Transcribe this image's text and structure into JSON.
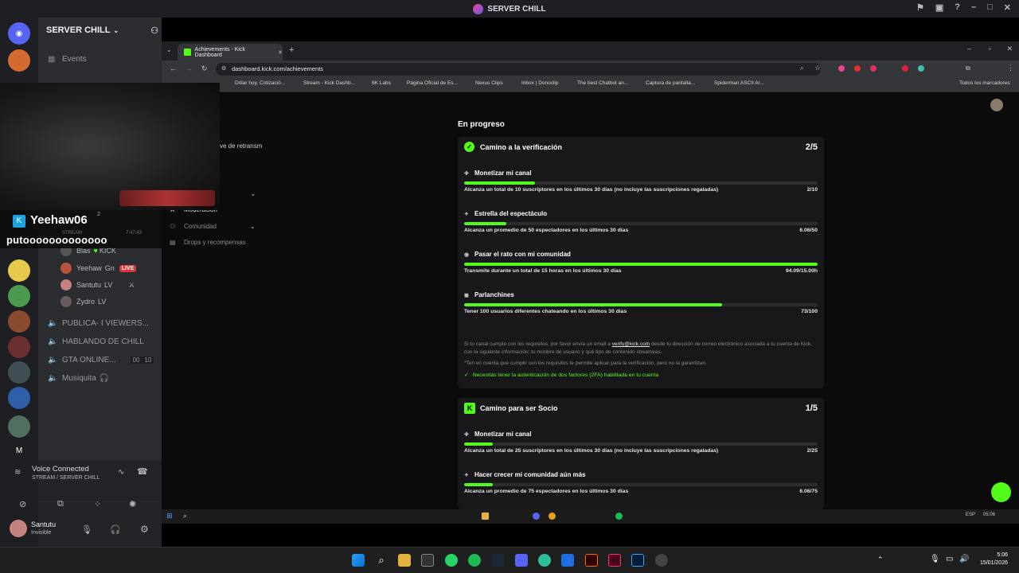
{
  "discord": {
    "title": "SERVER CHILL",
    "server_name": "SERVER CHILL",
    "events_label": "Events",
    "chat_overlay": {
      "name": "Yeehaw06",
      "message": "putooooooooooooo",
      "badge": "2",
      "time": "7:47:43",
      "stream_label": "STREAM"
    },
    "voice_users": [
      {
        "name": "Blas",
        "tag": "KICK",
        "live": false
      },
      {
        "name": "Yeehaw",
        "tag": "Gn",
        "live": true
      },
      {
        "name": "Santutu",
        "tag": "LV",
        "live": false
      },
      {
        "name": "Zydro",
        "tag": "LV",
        "live": false
      }
    ],
    "live_label": "LIVE",
    "voice_channels": [
      {
        "name": "PUBLICA- I VIEWERS..."
      },
      {
        "name": "HABLANDO DE CHILL"
      },
      {
        "name": "GTA ONLINE...",
        "count_a": "00",
        "count_b": "10"
      },
      {
        "name": "Musiquita"
      }
    ],
    "voice_status": "Voice Connected",
    "voice_channel": "STREAM / SERVER CHILL",
    "user": {
      "name": "Santutu",
      "status": "Invisible"
    }
  },
  "browser": {
    "tab_title": "Achievements - Kick Dashboard",
    "url": "dashboard.kick.com/achievements",
    "bookmarks": [
      "Dólar hoy, Cotizació...",
      "Stream - Kick Dashb...",
      "6K Labs",
      "Página Oficial de Es...",
      "Nexus Clips",
      "Inbox | Donoclip",
      "The best Chatbot an...",
      "Captura de pantalla...",
      "Spiderman ASCII Ar..."
    ],
    "all_bookmarks": "Todos los marcadores"
  },
  "dashboard": {
    "sidebar": [
      {
        "label": "ve de retransm"
      },
      {
        "label": "Moderación"
      },
      {
        "label": "Comunidad"
      },
      {
        "label": "Drops y recompensas"
      }
    ],
    "section_title": "En progreso",
    "verification": {
      "title": "Camino a la verificación",
      "score": "2/5",
      "tasks": [
        {
          "title": "Monetizar mi canal",
          "desc": "Alcanza un total de 10 suscriptores en los últimos 30 días (no incluye las suscripciones regaladas)",
          "value": "2/10",
          "progress": 0.2
        },
        {
          "title": "Estrella del espectáculo",
          "desc": "Alcanza un promedio de 50 espectadores en los últimos 30 días",
          "value": "6.06/50",
          "progress": 0.12
        },
        {
          "title": "Pasar el rato con mi comunidad",
          "desc": "Transmite durante un total de 15 horas en los últimos 30 días",
          "value": "94.09/15.00h",
          "progress": 1.0
        },
        {
          "title": "Parlanchines",
          "desc": "Tener 100 usuarios diferentes chateando en los últimos 30 días",
          "value": "73/100",
          "progress": 0.73
        }
      ],
      "note_1_pre": "Si tu canal cumple con los requisitos, por favor envía un email a",
      "note_email": "verify@kick.com",
      "note_1_post": "desde tu dirección de correo electrónico asociada a tu cuenta de Kick, con la siguiente información: tu nombre de usuario y qué tipo de contenido streameas.",
      "note_2": "*Ten en cuenta que cumplir con los requisitos te permite aplicar para la verificación, pero no la garantizan.",
      "requirement": "Necesitas tener la autenticación de dos factores (2FA) habilitada en tu cuenta"
    },
    "partner": {
      "title": "Camino para ser Socio",
      "score": "1/5",
      "tasks": [
        {
          "title": "Monetizar mi canal",
          "desc": "Alcanza un total de 25 suscriptores en los últimos 30 días (no incluye las suscripciones regaladas)",
          "value": "2/25",
          "progress": 0.08
        },
        {
          "title": "Hacer crecer mi comunidad aún más",
          "desc": "Alcanza un promedio de 75 espectadores en los últimos 30 días",
          "value": "6.06/75",
          "progress": 0.08
        }
      ]
    }
  },
  "taskbar": {
    "time": "5:06",
    "date": "15/01/2026",
    "lang": "ESP",
    "inner_time": "05:06"
  },
  "colors": {
    "kick_green": "#53fc18",
    "discord_bg": "#2b2d31",
    "live_red": "#da373c"
  }
}
